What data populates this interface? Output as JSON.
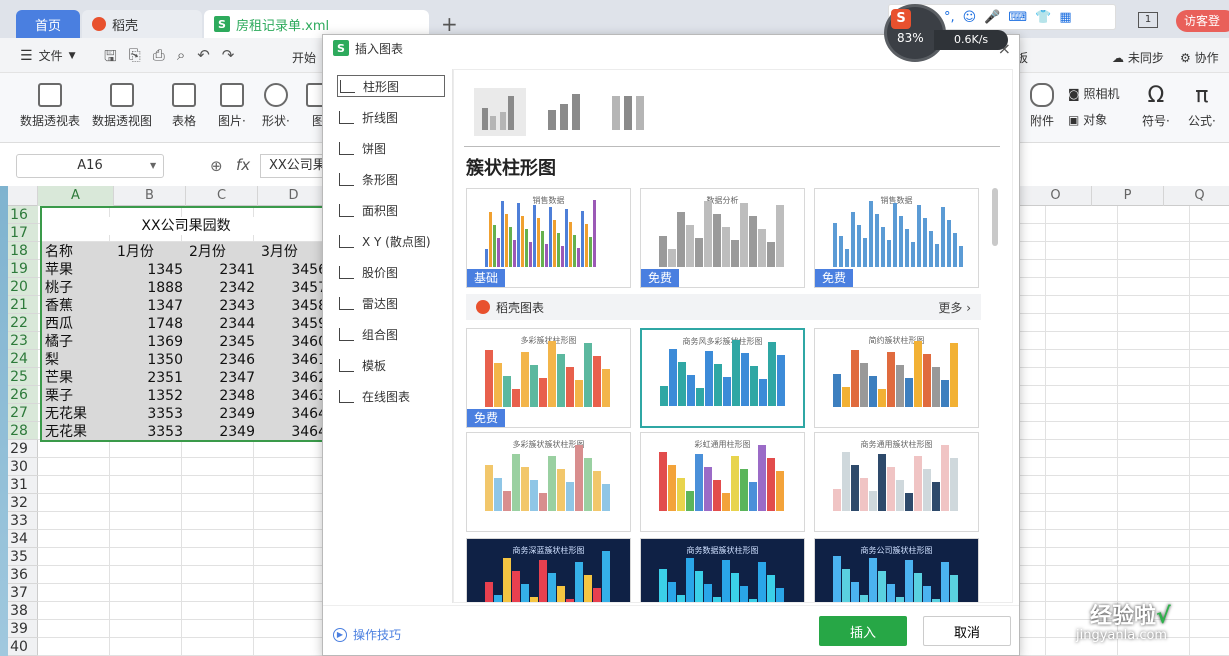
{
  "window": {
    "tabs": [
      {
        "label": "首页"
      },
      {
        "label": "稻壳"
      },
      {
        "label": "房租记录单.xml"
      }
    ],
    "new_tab": "+",
    "login": "访客登",
    "ime": {
      "lang": "中",
      "punct": "°,"
    },
    "net_speed": "0.6K/s",
    "widget_value": "83%"
  },
  "toolbar": {
    "menu_label": "文件",
    "start_tab": "开始"
  },
  "ribbon": {
    "items": [
      {
        "label": "数据透视表"
      },
      {
        "label": "数据透视图"
      },
      {
        "label": "表格"
      },
      {
        "label": "图片·"
      },
      {
        "label": "形状·"
      },
      {
        "label": "图"
      }
    ],
    "right_items": [
      {
        "label": "附件"
      },
      {
        "label": "照相机"
      },
      {
        "label": "对象"
      },
      {
        "label": "符号·"
      },
      {
        "label": "公式·"
      }
    ],
    "sync": "未同步",
    "collab": "协作",
    "board": "板"
  },
  "formula_bar": {
    "name_box": "A16",
    "fx": "fx",
    "content": "XX公司果"
  },
  "sheet": {
    "columns": [
      "A",
      "B",
      "C",
      "D",
      "O",
      "P",
      "Q"
    ],
    "rows": [
      16,
      17,
      18,
      19,
      20,
      21,
      22,
      23,
      24,
      25,
      26,
      27,
      28,
      29,
      30,
      31,
      32,
      33,
      34,
      35,
      36,
      37,
      38,
      39,
      40
    ],
    "title": "XX公司果园数",
    "header": [
      "名称",
      "1月份",
      "2月份",
      "3月份"
    ],
    "data": [
      [
        "苹果",
        "1345",
        "2341",
        "3456"
      ],
      [
        "桃子",
        "1888",
        "2342",
        "3457"
      ],
      [
        "香蕉",
        "1347",
        "2343",
        "3458"
      ],
      [
        "西瓜",
        "1748",
        "2344",
        "3459"
      ],
      [
        "橘子",
        "1369",
        "2345",
        "3460"
      ],
      [
        "梨",
        "1350",
        "2346",
        "3461"
      ],
      [
        "芒果",
        "2351",
        "2347",
        "3462"
      ],
      [
        "栗子",
        "1352",
        "2348",
        "3463"
      ],
      [
        "无花果",
        "3353",
        "2349",
        "3464"
      ],
      [
        "无花果",
        "3353",
        "2349",
        "3464"
      ]
    ]
  },
  "dialog": {
    "title": "插入图表",
    "close": "×",
    "nav": [
      {
        "label": "柱形图"
      },
      {
        "label": "折线图"
      },
      {
        "label": "饼图"
      },
      {
        "label": "条形图"
      },
      {
        "label": "面积图"
      },
      {
        "label": "X Y (散点图)"
      },
      {
        "label": "股价图"
      },
      {
        "label": "雷达图"
      },
      {
        "label": "组合图"
      },
      {
        "label": "模板"
      },
      {
        "label": "在线图表"
      }
    ],
    "chart_title": "簇状柱形图",
    "badges": {
      "basic": "基础",
      "free": "免费"
    },
    "docer_label": "稻壳图表",
    "more": "更多",
    "thumbs": [
      {
        "title": "销售数据"
      },
      {
        "title": "数据分析"
      },
      {
        "title": "销售数据"
      },
      {
        "title": "多彩簇状柱形图"
      },
      {
        "title": "商务风多彩簇状柱形图"
      },
      {
        "title": "简约簇状柱形图"
      },
      {
        "title": "多彩簇状簇状柱形图"
      },
      {
        "title": "彩虹通用柱形图"
      },
      {
        "title": "商务通用簇状柱形图"
      },
      {
        "title": "商务深蓝簇状柱形图"
      },
      {
        "title": "商务数据簇状柱形图"
      },
      {
        "title": "商务公司簇状柱形图"
      }
    ],
    "tips": "操作技巧",
    "insert": "插入",
    "cancel": "取消"
  },
  "watermark": {
    "main": "经验啦",
    "sub": "jingyanla.com",
    "check": "√"
  },
  "colors": {
    "accent_green": "#27a746",
    "badge_blue": "#4a7fe0",
    "tab_blue": "#4a7fe0"
  }
}
